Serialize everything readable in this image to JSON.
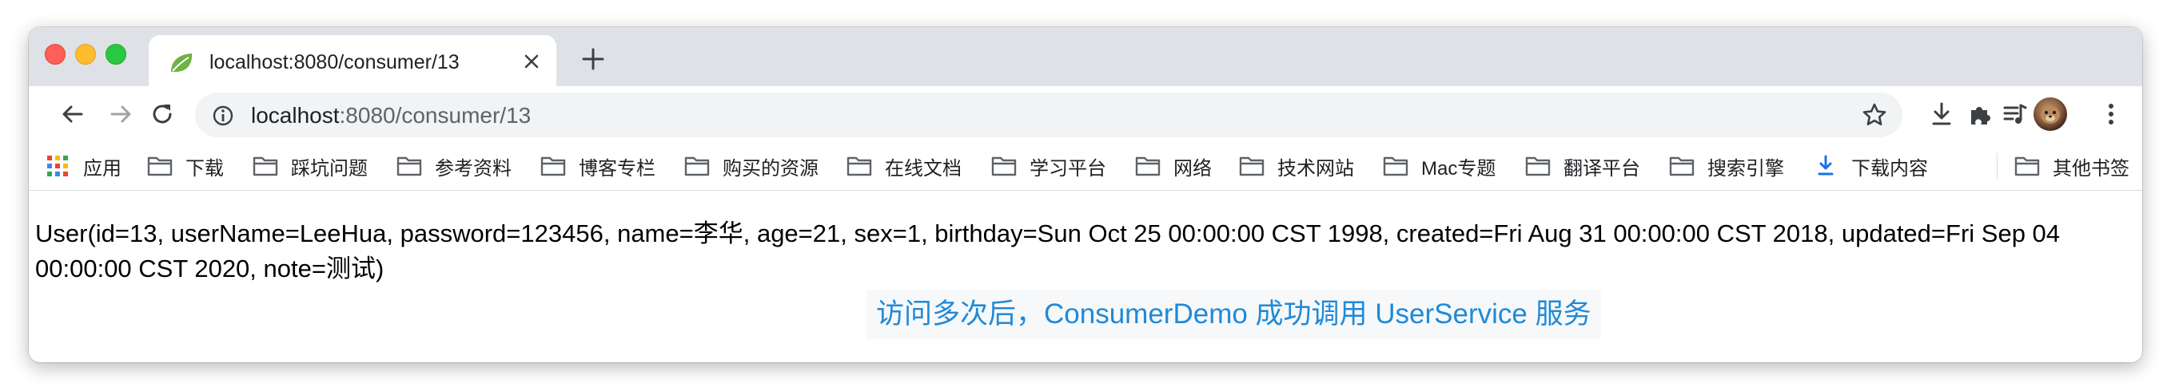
{
  "window": {
    "traffic_lights": [
      "close",
      "minimize",
      "zoom"
    ]
  },
  "tab": {
    "title": "localhost:8080/consumer/13",
    "favicon": "spring-leaf-icon",
    "favicon_color": "#6db33f"
  },
  "toolbar": {
    "url_host": "localhost",
    "url_rest": ":8080/consumer/13",
    "icons": [
      "back-icon",
      "forward-icon",
      "reload-icon",
      "info-icon",
      "star-icon",
      "download-icon",
      "extensions-icon",
      "reading-list-icon",
      "avatar",
      "more-icon"
    ]
  },
  "bookmarks": {
    "items": [
      {
        "label": "应用",
        "icon": "apps-grid-icon"
      },
      {
        "label": "下载",
        "icon": "folder-icon"
      },
      {
        "label": "踩坑问题",
        "icon": "folder-icon"
      },
      {
        "label": "参考资料",
        "icon": "folder-icon"
      },
      {
        "label": "博客专栏",
        "icon": "folder-icon"
      },
      {
        "label": "购买的资源",
        "icon": "folder-icon"
      },
      {
        "label": "在线文档",
        "icon": "folder-icon"
      },
      {
        "label": "学习平台",
        "icon": "folder-icon"
      },
      {
        "label": "网络",
        "icon": "folder-icon"
      },
      {
        "label": "技术网站",
        "icon": "folder-icon"
      },
      {
        "label": "Mac专题",
        "icon": "folder-icon"
      },
      {
        "label": "翻译平台",
        "icon": "folder-icon"
      },
      {
        "label": "搜索引擎",
        "icon": "folder-icon"
      },
      {
        "label": "下载内容",
        "icon": "download-arrow-icon"
      }
    ],
    "other": {
      "label": "其他书签",
      "icon": "folder-icon"
    }
  },
  "content": {
    "user_record": "User(id=13, userName=LeeHua, password=123456, name=李华, age=21, sex=1, birthday=Sun Oct 25 00:00:00 CST 1998, created=Fri Aug 31 00:00:00 CST 2018, updated=Fri Sep 04 00:00:00 CST 2020, note=测试)",
    "caption": "访问多次后，ConsumerDemo 成功调用 UserService 服务",
    "caption_color": "#1f8ad8"
  }
}
